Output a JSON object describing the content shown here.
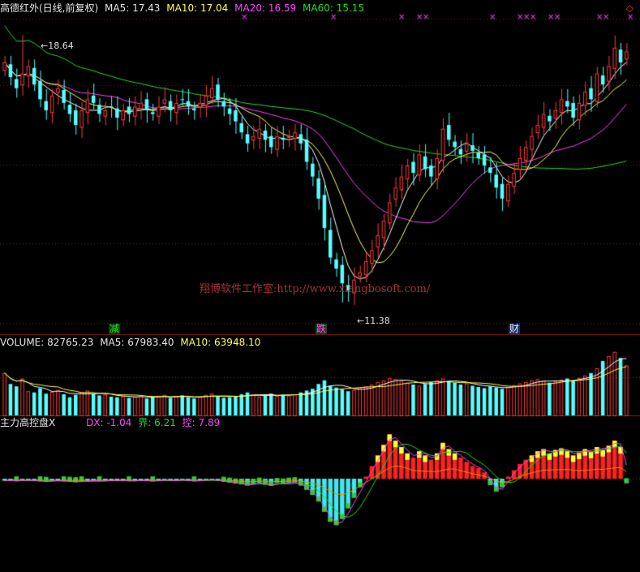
{
  "header": {
    "title": "高德红外(日线,前复权)",
    "ma5_label": "MA5: 17.43",
    "ma10_label": "MA10: 17.04",
    "ma20_label": "MA20: 16.59",
    "ma60_label": "MA60: 15.15"
  },
  "volume_header": {
    "volume_label": "VOLUME: 82765.23",
    "ma5_label": "MA5: 67983.40",
    "ma10_label": "MA10: 63948.10"
  },
  "indicator_header": {
    "name": "主力高控盘X",
    "dx_label": "DX: -1.04",
    "jie_label": "界: 6.21",
    "kong_label": "控: 7.89"
  },
  "annotations": {
    "high_label": "18.64",
    "low_label": "11.38",
    "tag_jian": "减",
    "tag_die": "跌",
    "tag_cai": "财",
    "watermark": "翔博软件工作室:http://www.xiangbosoft.com/"
  },
  "colors": {
    "up": "#ff3a3a",
    "down": "#54ffff",
    "ma5": "#ffffff",
    "ma10": "#ffff55",
    "ma20": "#ff44ff",
    "ma60": "#22dd22",
    "grid": "#8b1a1a",
    "cross_marks": "#ff44ff",
    "dx_line": "#ff44ff",
    "jie_line": "#22dd22",
    "kong_line": "#ff8a00"
  },
  "chart_data": {
    "type": "candlestick",
    "price_high": 18.64,
    "price_low": 11.38,
    "closes": [
      17.9,
      17.5,
      17.2,
      17.6,
      17.8,
      17.3,
      16.9,
      16.6,
      17.0,
      17.2,
      16.8,
      16.5,
      16.2,
      16.6,
      16.9,
      16.8,
      16.5,
      16.6,
      16.7,
      16.4,
      16.6,
      16.5,
      16.7,
      16.8,
      16.6,
      16.5,
      16.7,
      16.9,
      16.6,
      16.8,
      16.9,
      16.7,
      16.6,
      16.8,
      17.0,
      17.2,
      16.9,
      16.7,
      16.5,
      16.3,
      16.0,
      15.7,
      15.9,
      16.1,
      15.8,
      15.6,
      15.9,
      15.8,
      15.9,
      16.0,
      15.7,
      15.2,
      14.8,
      14.2,
      13.4,
      12.6,
      12.3,
      11.9,
      11.7,
      12.0,
      12.2,
      12.5,
      12.8,
      13.2,
      13.6,
      14.1,
      14.5,
      14.8,
      15.1,
      14.9,
      15.4,
      15.0,
      14.8,
      15.3,
      16.1,
      15.8,
      15.6,
      15.4,
      15.7,
      15.5,
      15.3,
      15.1,
      14.9,
      14.5,
      14.2,
      14.6,
      14.9,
      15.3,
      15.6,
      15.9,
      16.2,
      16.5,
      16.3,
      16.6,
      16.9,
      16.7,
      16.4,
      16.8,
      17.1,
      16.9,
      17.6,
      17.3,
      17.8,
      18.3,
      17.9,
      18.2
    ],
    "ma_periods": [
      5,
      10,
      20,
      60
    ],
    "ma_last": [
      17.43,
      17.04,
      16.59,
      15.15
    ],
    "volumes": [
      70000,
      52000,
      48000,
      61000,
      40000,
      38000,
      45000,
      36000,
      39000,
      42000,
      35000,
      30000,
      34000,
      38000,
      41000,
      36000,
      33000,
      35000,
      31000,
      30000,
      32000,
      29000,
      31000,
      33000,
      28000,
      30000,
      32000,
      34000,
      29000,
      31000,
      33000,
      30000,
      28000,
      31000,
      34000,
      36000,
      31000,
      29000,
      30000,
      32000,
      35000,
      38000,
      34000,
      31000,
      33000,
      36000,
      32000,
      34000,
      33000,
      35000,
      38000,
      41000,
      44000,
      52000,
      58000,
      49000,
      46000,
      43000,
      40000,
      42000,
      45000,
      48000,
      51000,
      55000,
      58000,
      62000,
      60000,
      57000,
      54000,
      51000,
      49000,
      52000,
      55000,
      58000,
      61000,
      57000,
      54000,
      51000,
      53000,
      49000,
      47000,
      45000,
      48000,
      46000,
      44000,
      47000,
      50000,
      53000,
      55000,
      58000,
      60000,
      57000,
      54000,
      56000,
      59000,
      61000,
      58000,
      62000,
      66000,
      70000,
      78000,
      90000,
      98000,
      105000,
      95000,
      82765
    ],
    "vol_ma_last": [
      67983.4,
      63948.1
    ],
    "dx": [
      -0.5,
      -0.4,
      -0.6,
      -0.3,
      -0.4,
      -0.5,
      -0.6,
      -0.7,
      -0.5,
      -0.4,
      -0.6,
      -0.7,
      -0.8,
      -0.6,
      -0.5,
      -0.4,
      -0.6,
      -0.5,
      -0.4,
      -0.5,
      -0.4,
      -0.6,
      -0.5,
      -0.4,
      -0.5,
      -0.6,
      -0.4,
      -0.3,
      -0.5,
      -0.4,
      -0.3,
      -0.5,
      -0.6,
      -0.4,
      -0.3,
      -0.2,
      -0.5,
      -0.7,
      -0.9,
      -1.1,
      -1.3,
      -1.6,
      -1.2,
      -0.9,
      -1.4,
      -1.7,
      -1.0,
      -1.1,
      -0.9,
      -0.8,
      -1.6,
      -2.6,
      -3.8,
      -5.4,
      -7.8,
      -10.2,
      -11.0,
      -9.5,
      -7.0,
      -4.5,
      -2.0,
      0.5,
      3.0,
      5.5,
      8.0,
      10.5,
      9.0,
      7.5,
      6.0,
      5.0,
      6.5,
      5.5,
      4.5,
      6.0,
      8.5,
      7.0,
      6.0,
      5.0,
      4.0,
      3.0,
      2.5,
      1.5,
      -1.5,
      -3.0,
      -2.0,
      0.5,
      2.0,
      3.5,
      4.5,
      5.5,
      6.5,
      7.0,
      6.0,
      6.8,
      7.2,
      6.5,
      5.5,
      6.2,
      7.0,
      6.4,
      7.5,
      6.8,
      7.8,
      9.0,
      7.5,
      -1.04
    ],
    "jie_last": 6.21,
    "kong_last": 7.89
  }
}
